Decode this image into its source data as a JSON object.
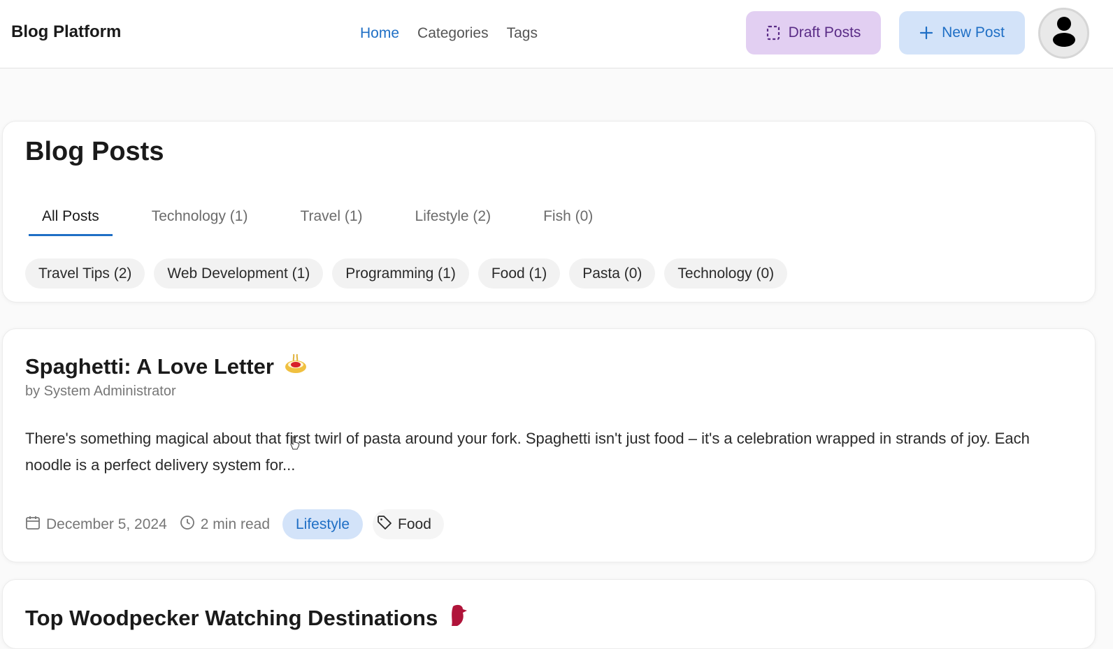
{
  "header": {
    "brand": "Blog Platform",
    "nav": [
      "Home",
      "Categories",
      "Tags"
    ],
    "active_nav": "Home",
    "draft_button": {
      "label": "Draft Posts",
      "icon": "dashed-square-icon"
    },
    "new_post_button": {
      "label": "New Post",
      "icon": "plus-icon"
    },
    "avatar_icon": "user-icon"
  },
  "main": {
    "title": "Blog Posts",
    "tabs": [
      "All Posts",
      "Technology (1)",
      "Travel (1)",
      "Lifestyle (2)",
      "Fish (0)"
    ],
    "active_tab": "All Posts",
    "tag_chips": [
      "Travel Tips (2)",
      "Web Development (1)",
      "Programming (1)",
      "Food (1)",
      "Pasta (0)",
      "Technology (0)"
    ]
  },
  "posts": [
    {
      "title": "Spaghetti: A Love Letter",
      "title_icon": "spaghetti-emoji",
      "author": "by System Administrator",
      "excerpt": "There's something magical about that first twirl of pasta around your fork. Spaghetti isn't just food – it's a celebration wrapped in strands of joy. Each noodle is a perfect delivery system for...",
      "date": "December 5, 2024",
      "read_time": "2 min read",
      "category": "Lifestyle",
      "tag": "Food"
    },
    {
      "title": "Top Woodpecker Watching Destinations",
      "title_icon": "woodpecker-emoji"
    }
  ],
  "colors": {
    "accent": "#1f6fc5",
    "draft_bg": "#e2cff2",
    "draft_text": "#5a2c86",
    "new_post_bg": "#d3e3f9",
    "chip_bg": "#f2f2f2"
  }
}
